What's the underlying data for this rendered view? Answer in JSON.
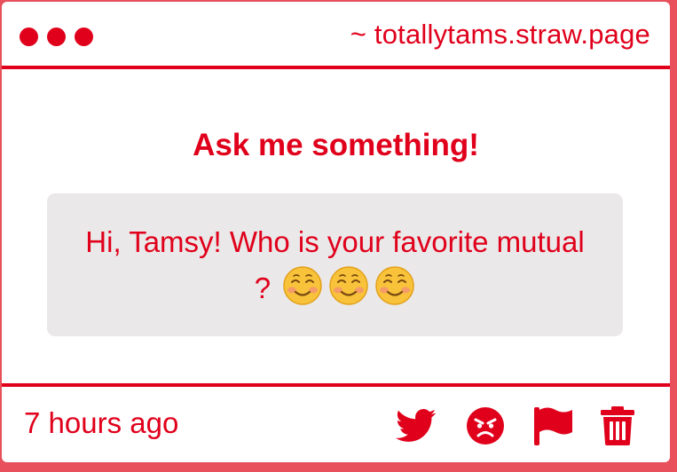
{
  "window": {
    "url": "~ totallytams.straw.page",
    "controls": [
      "dot-1",
      "dot-2",
      "dot-3"
    ]
  },
  "main": {
    "heading": "Ask me something!",
    "question": {
      "text": "Hi, Tamsy! Who is your favorite mutual ?",
      "emojis": [
        "smiling-face-icon",
        "smiling-face-icon",
        "smiling-face-icon"
      ]
    }
  },
  "footer": {
    "timestamp": "7 hours ago",
    "actions": [
      "twitter-icon",
      "angry-face-icon",
      "flag-icon",
      "trash-icon"
    ]
  },
  "colors": {
    "accent": "#e0001b",
    "background": "#e8505b",
    "question_bg": "#eae8e8",
    "emoji_face": "#f8c33a"
  }
}
